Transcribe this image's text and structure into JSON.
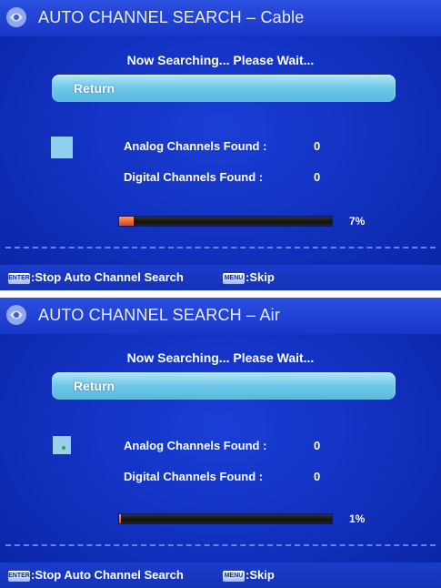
{
  "screens": [
    {
      "title": "AUTO CHANNEL SEARCH – Cable",
      "status": "Now Searching...  Please Wait...",
      "return_label": "Return",
      "analog_label": "Analog Channels Found :",
      "analog_value": "0",
      "digital_label": "Digital Channels Found :",
      "digital_value": "0",
      "progress_percent": 7,
      "progress_text": "7%",
      "enter_key": "ENTER",
      "enter_action": ":Stop Auto Channel Search",
      "menu_key": "MENU",
      "menu_action": ":Skip"
    },
    {
      "title": "AUTO CHANNEL SEARCH – Air",
      "status": "Now Searching...  Please Wait...",
      "return_label": "Return",
      "analog_label": "Analog Channels Found :",
      "analog_value": "0",
      "digital_label": "Digital Channels Found :",
      "digital_value": "0",
      "progress_percent": 1,
      "progress_text": "1%",
      "enter_key": "ENTER",
      "enter_action": ":Stop Auto Channel Search",
      "menu_key": "MENU",
      "menu_action": ":Skip"
    }
  ],
  "colors": {
    "background": "#1232c2",
    "return_bar": "#6fc8e8",
    "progress_fill": "#e2401a",
    "dash_line": "#5d83ff"
  },
  "icons": [
    "tv-logo-icon",
    "enter-key-icon",
    "menu-key-icon"
  ]
}
